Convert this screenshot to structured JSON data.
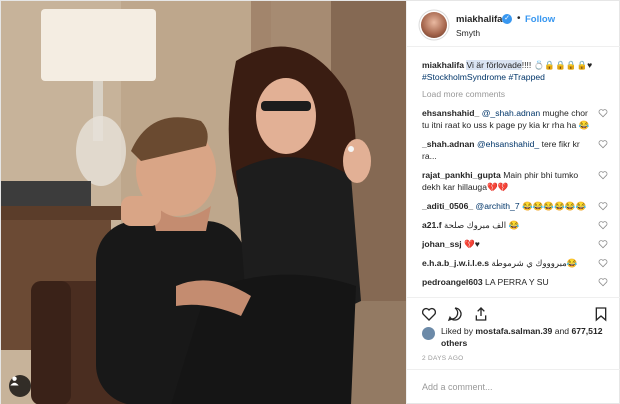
{
  "header": {
    "username": "miakhalifa",
    "verified_mark": "✓",
    "separator": "•",
    "follow_label": "Follow",
    "location": "Smyth"
  },
  "caption": {
    "username": "miakhalifa",
    "text_highlight": "Vi är förlovade",
    "text_rest": "!!!! 💍🔒🔒🔒🔒♥",
    "hashtags": "#StockholmSyndrome #Trapped"
  },
  "load_more_label": "Load more comments",
  "comments": [
    {
      "user": "ehsanshahid_",
      "mention": "@_shah.adnan",
      "text": " mughe chor tu itni raat ko uss k page py kia kr rha ha 😂"
    },
    {
      "user": "_shah.adnan",
      "mention": "@ehsanshahid_",
      "text": " tere fikr kr ra..."
    },
    {
      "user": "rajat_pankhi_gupta",
      "mention": "",
      "text": "Main phir bhi tumko dekh kar hillauga💔💔"
    },
    {
      "user": "_aditi_0506_",
      "mention": "@archith_7",
      "text": " 😂😂😂😂😂😂"
    },
    {
      "user": "a21.f",
      "mention": "",
      "text": "الف مبروك صلحة 😂"
    },
    {
      "user": "johan_ssj",
      "mention": "",
      "text": "💔♥"
    },
    {
      "user": "e.h.a.b_j.w.i.l.e.s",
      "mention": "",
      "text": "مبروووك ي شرموطة😂"
    },
    {
      "user": "pedroangel603",
      "mention": "",
      "text": "LA PERRA Y SU"
    }
  ],
  "likes": {
    "prefix": "Liked by ",
    "user": "mostafa.salman.39",
    "middle": " and ",
    "count": "677,512 others"
  },
  "timestamp": "2 DAYS AGO",
  "add_comment_placeholder": "Add a comment...",
  "colors": {
    "follow": "#3897f0",
    "verified": "#3897f0",
    "hashtag": "#003569",
    "muted": "#999999"
  },
  "icons": [
    "heart-icon",
    "comment-icon",
    "share-icon",
    "save-icon",
    "user-tag-icon",
    "verified-icon"
  ]
}
